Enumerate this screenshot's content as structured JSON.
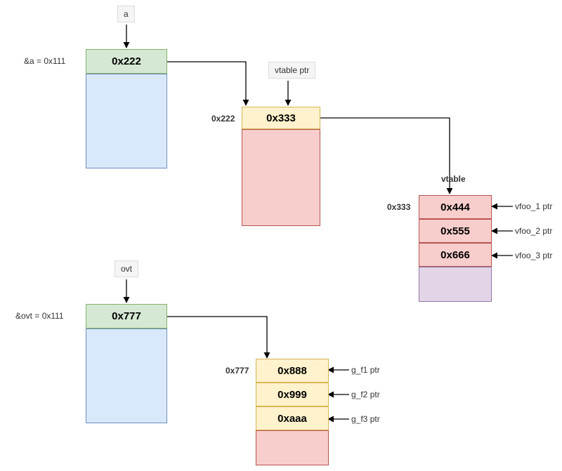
{
  "topLabel": "a",
  "topAddrLabel": "&a = 0x111",
  "topHeader": "0x222",
  "vtablePtrLabel": "vtable ptr",
  "midAddrLabel": "0x222",
  "midHeader": "0x333",
  "vtableLabel": "vtable",
  "vtableAddr": "0x333",
  "vt": [
    {
      "val": "0x444",
      "ptr": "vfoo_1 ptr"
    },
    {
      "val": "0x555",
      "ptr": "vfoo_2 ptr"
    },
    {
      "val": "0x666",
      "ptr": "vfoo_3 ptr"
    }
  ],
  "ovtLabel": "ovt",
  "ovtAddrLabel": "&ovt = 0x111",
  "ovtHeader": "0x777",
  "ovtTableAddr": "0x777",
  "ot": [
    {
      "val": "0x888",
      "ptr": "g_f1 ptr"
    },
    {
      "val": "0x999",
      "ptr": "g_f2 ptr"
    },
    {
      "val": "0xaaa",
      "ptr": "g_f3 ptr"
    }
  ]
}
